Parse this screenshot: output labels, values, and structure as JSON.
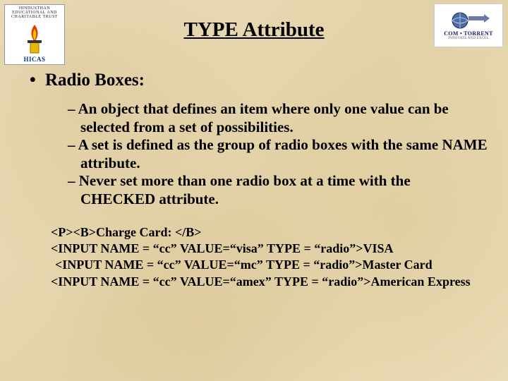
{
  "logo_left": {
    "top_text": "HINDUSTHAN EDUCATIONAL AND CHARITABLE TRUST",
    "bottom_text": "HICAS"
  },
  "logo_right": {
    "brand": "COM • TORRENT",
    "tag": "INNOVATE AND EXCEL"
  },
  "title": "TYPE Attribute",
  "section_heading": "Radio Boxes:",
  "sub_bullets": [
    "An object that defines an item where only one value can be selected from a set of possibilities.",
    "A set is defined as the group of radio boxes with the same NAME attribute.",
    "Never set more than one radio box at a time with the CHECKED attribute."
  ],
  "code_lines": [
    "<P><B>Charge Card: </B>",
    "<INPUT NAME = “cc” VALUE=“visa” TYPE = “radio”>VISA",
    "<INPUT NAME = “cc” VALUE=“mc” TYPE = “radio”>Master Card",
    "<INPUT NAME = “cc” VALUE=“amex” TYPE = “radio”>American Express"
  ]
}
